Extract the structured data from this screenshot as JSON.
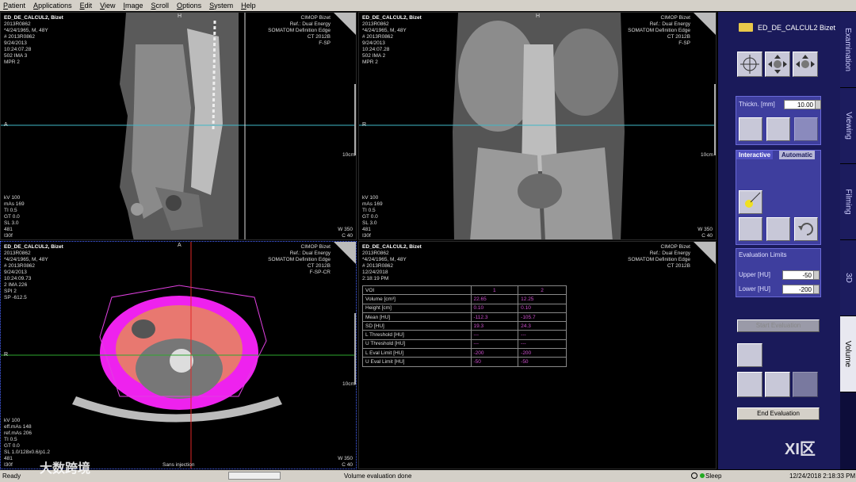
{
  "menu": [
    "Patient",
    "Applications",
    "Edit",
    "View",
    "Image",
    "Scroll",
    "Options",
    "System",
    "Help"
  ],
  "patient": {
    "name": "ED_DE_CALCUL2, Bizet",
    "id": "2013R0862",
    "dob": "*4/24/1965, M, 48Y",
    "acc": "# 2013R0862",
    "date": "9/24/2013"
  },
  "site": {
    "hospital": "CIMOP Bizet",
    "ref": "Ref.: Dual Energy",
    "scanner": "SOMATOM Definition Edge",
    "version": "CT 2012B"
  },
  "vp1": {
    "time": "10:24:07.28",
    "ima": "502 IMA 3",
    "mpr": "MPR 2",
    "f": "F-SP",
    "top": "H",
    "left": "A",
    "scale": "10cm",
    "params": "kV 100\nmAs 169\nTI 0.5\nGT 0.0\nSL 3.0\n481\nI30f",
    "wc": "W 350\nC 40"
  },
  "vp2": {
    "time": "10:24:07.28",
    "ima": "502 IMA 2",
    "mpr": "MPR 2",
    "f": "F-SP",
    "top": "H",
    "left": "R",
    "scale": "10cm",
    "params": "kV 100\nmAs 169\nTI 0.5\nGT 0.0\nSL 3.0\n481\nI30f",
    "wc": "W 350\nC 40"
  },
  "vp3": {
    "time": "10:24:09.73",
    "ima": "2 IMA 226",
    "spi": "SPI 2",
    "sp": "SP -612.5",
    "f": "F-SP-CR",
    "top": "A",
    "left": "R",
    "scale": "10cm",
    "params": "kV 100\neff.mAs 148\nref.mAs 206\nTI 0.5\nGT 0.0\nSL 1.0/128x0.6/p1.2\n481\nI30f",
    "injection": "Sans injection",
    "wc": "W 350\nC 40"
  },
  "vp4": {
    "created": "12/24/2018\n2:18:19 PM",
    "table": {
      "header": [
        "VOI",
        "1",
        "2"
      ],
      "rows": [
        [
          "Volume [cm³]",
          "22.65",
          "12.25"
        ],
        [
          "Height [cm]",
          "0.10",
          "0.10"
        ],
        [
          "Mean [HU]",
          "-112.3",
          "-105.7"
        ],
        [
          "SD [HU]",
          "19.3",
          "24.3"
        ],
        [
          "L Threshold [HU]",
          "---",
          "---"
        ],
        [
          "U Threshold [HU]",
          "---",
          "---"
        ],
        [
          "L Eval Limit [HU]",
          "-200",
          "-200"
        ],
        [
          "U Eval Limit [HU]",
          "-50",
          "-50"
        ]
      ]
    }
  },
  "panel": {
    "title": "ED_DE_CALCUL2 Bizet",
    "thickness_label": "Thickn. [mm]",
    "thickness_value": "10.00",
    "tab_interactive": "Interactive",
    "tab_automatic": "Automatic",
    "eval_limits_title": "Evaluation Limits",
    "upper_label": "Upper [HU]",
    "upper_value": "-50",
    "lower_label": "Lower [HU]",
    "lower_value": "-200",
    "start_eval": "Start Evaluation",
    "end_eval": "End Evaluation"
  },
  "tabs": [
    "Examination",
    "Viewing",
    "Filming",
    "3D",
    "Volume"
  ],
  "status": {
    "left": "Ready",
    "center": "Volume evaluation done",
    "sleep": "Sleep",
    "datetime": "12/24/2018 2:18:33 PM"
  },
  "watermark": {
    "left": "大数跨境",
    "right": "XI区"
  }
}
